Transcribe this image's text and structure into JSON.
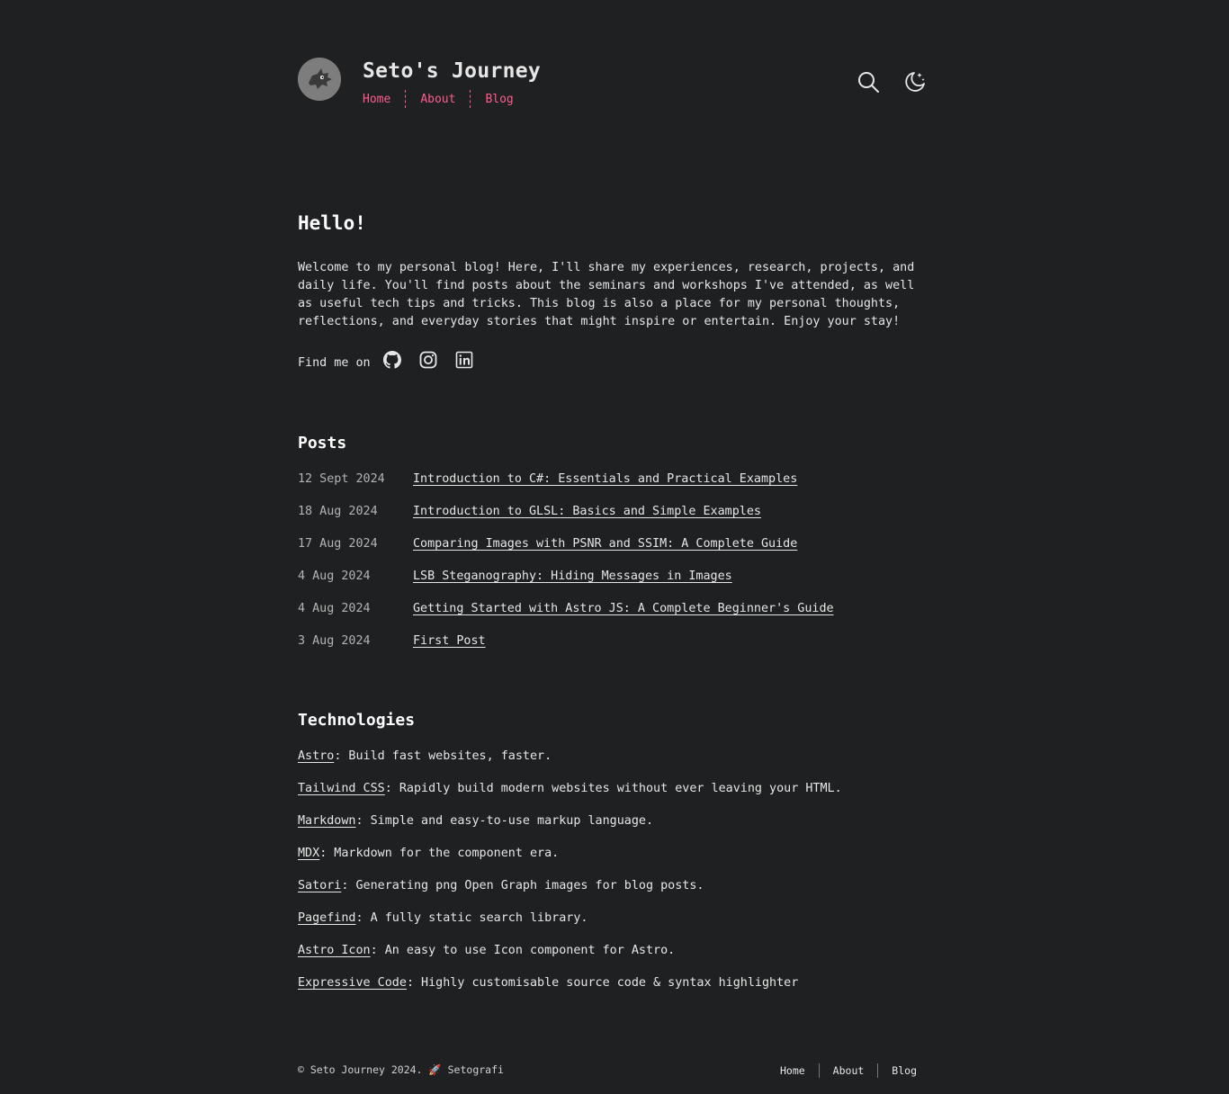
{
  "header": {
    "title": "Seto's Journey",
    "nav": [
      "Home",
      "About",
      "Blog"
    ]
  },
  "intro": {
    "heading": "Hello!",
    "text": "Welcome to my personal blog! Here, I'll share my experiences, research, projects, and daily life. You'll find posts about the seminars and workshops I've attended, as well as useful tech tips and tricks. This blog is also a place for my personal thoughts, reflections, and everyday stories that might inspire or entertain. Enjoy your stay!",
    "find_me": "Find me on",
    "social_icons": [
      "github-icon",
      "instagram-icon",
      "linkedin-icon"
    ]
  },
  "posts": {
    "heading": "Posts",
    "items": [
      {
        "date": "12 Sept 2024",
        "title": "Introduction to C#: Essentials and Practical Examples"
      },
      {
        "date": "18 Aug 2024",
        "title": "Introduction to GLSL: Basics and Simple Examples"
      },
      {
        "date": "17 Aug 2024",
        "title": "Comparing Images with PSNR and SSIM: A Complete Guide"
      },
      {
        "date": "4 Aug 2024",
        "title": "LSB Steganography: Hiding Messages in Images"
      },
      {
        "date": "4 Aug 2024",
        "title": "Getting Started with Astro JS: A Complete Beginner's Guide"
      },
      {
        "date": "3 Aug 2024",
        "title": "First Post"
      }
    ]
  },
  "technologies": {
    "heading": "Technologies",
    "items": [
      {
        "name": "Astro",
        "desc": ": Build fast websites, faster."
      },
      {
        "name": "Tailwind CSS",
        "desc": ": Rapidly build modern websites without ever leaving your HTML."
      },
      {
        "name": "Markdown",
        "desc": ": Simple and easy-to-use markup language."
      },
      {
        "name": "MDX",
        "desc": ": Markdown for the component era."
      },
      {
        "name": "Satori",
        "desc": ": Generating png Open Graph images for blog posts."
      },
      {
        "name": "Pagefind",
        "desc": ": A fully static search library."
      },
      {
        "name": "Astro Icon",
        "desc": ": An easy to use Icon component for Astro."
      },
      {
        "name": "Expressive Code",
        "desc": ": Highly customisable source code & syntax highlighter"
      }
    ]
  },
  "footer": {
    "copyright": "© Seto Journey 2024. 🚀 Setografi",
    "nav": [
      "Home",
      "About",
      "Blog"
    ]
  },
  "colors": {
    "background": "#1f2022",
    "accent": "#ff5c8d",
    "text": "#e6e6e6"
  }
}
